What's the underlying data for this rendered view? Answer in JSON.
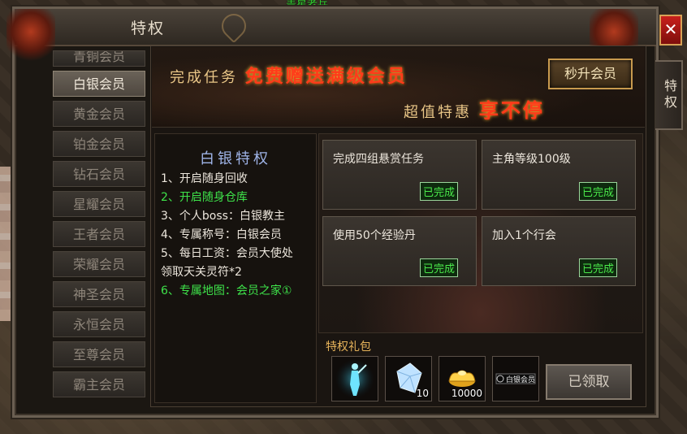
{
  "world": {
    "top_label": "盖星老兵"
  },
  "window": {
    "title": "特权",
    "close_glyph": "✕",
    "side_tab": "特权"
  },
  "nav": {
    "items": [
      {
        "label": "青铜会员",
        "active": false
      },
      {
        "label": "白银会员",
        "active": true
      },
      {
        "label": "黄金会员",
        "active": false
      },
      {
        "label": "铂金会员",
        "active": false
      },
      {
        "label": "钻石会员",
        "active": false
      },
      {
        "label": "星耀会员",
        "active": false
      },
      {
        "label": "王者会员",
        "active": false
      },
      {
        "label": "荣耀会员",
        "active": false
      },
      {
        "label": "神圣会员",
        "active": false
      },
      {
        "label": "永恒会员",
        "active": false
      },
      {
        "label": "至尊会员",
        "active": false
      },
      {
        "label": "霸主会员",
        "active": false
      }
    ]
  },
  "banner": {
    "line1_prefix": "完成任务",
    "line1_highlight": "免费赠送满级会员",
    "line2_prefix": "超值特惠",
    "line2_highlight": "享不停",
    "upgrade_button": "秒升会员"
  },
  "privileges": {
    "title": "白银特权",
    "items": [
      {
        "text": "1、开启随身回收",
        "highlight": false
      },
      {
        "text": "2、开启随身仓库",
        "highlight": true
      },
      {
        "text": "3、个人boss：白银教主",
        "highlight": false
      },
      {
        "text": "4、专属称号：白银会员",
        "highlight": false
      },
      {
        "text": "5、每日工资：会员大使处",
        "highlight": false
      },
      {
        "text": "领取天关灵符*2",
        "highlight": false
      },
      {
        "text": "6、专属地图：会员之家①",
        "highlight": true
      }
    ]
  },
  "tasks": [
    {
      "text": "完成四组悬赏任务",
      "status": "已完成"
    },
    {
      "text": "主角等级100级",
      "status": "已完成"
    },
    {
      "text": "使用50个经验丹",
      "status": "已完成"
    },
    {
      "text": "加入1个行会",
      "status": "已完成"
    }
  ],
  "gifts": {
    "label": "特权礼包",
    "items": [
      {
        "icon": "warrior-figure-icon",
        "qty": ""
      },
      {
        "icon": "blue-crystal-icon",
        "qty": "10"
      },
      {
        "icon": "gold-ingot-icon",
        "qty": "10000"
      },
      {
        "icon": "silver-member-title-icon",
        "qty": "",
        "title_text": "白银会员"
      }
    ],
    "claim_button": "已领取"
  },
  "colors": {
    "highlight_red": "#ff3b1a",
    "done_green": "#4bea4b",
    "list_green": "#3ee34a"
  }
}
